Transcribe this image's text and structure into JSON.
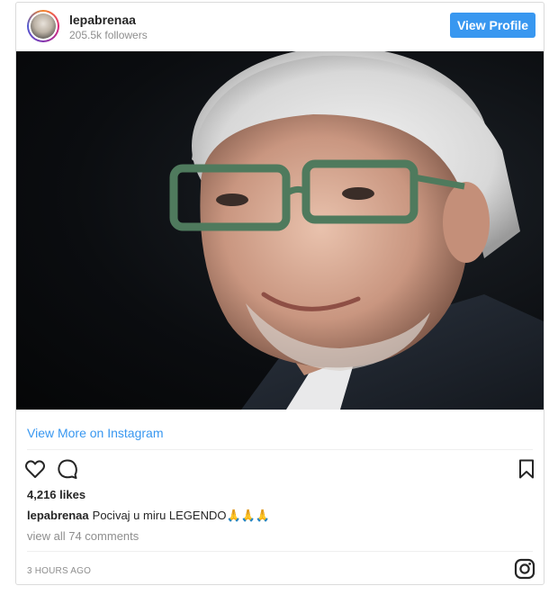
{
  "header": {
    "username": "lepabrenaa",
    "followers": "205.5k followers",
    "view_profile_label": "View Profile"
  },
  "media": {
    "description_icon": "portrait-photo"
  },
  "links": {
    "view_more_label": "View More on Instagram"
  },
  "actions": {
    "like_icon": "heart-icon",
    "comment_icon": "comment-icon",
    "save_icon": "bookmark-icon"
  },
  "post": {
    "likes": "4,216 likes",
    "caption_user": "lepabrenaa",
    "caption_text": "Pocivaj u miru LEGENDO🙏🙏🙏",
    "view_comments": "view all 74 comments",
    "time": "3 HOURS AGO"
  },
  "colors": {
    "accent": "#3897f0",
    "text": "#262626",
    "muted": "#8e8e8e",
    "border": "#dbdbdb"
  }
}
